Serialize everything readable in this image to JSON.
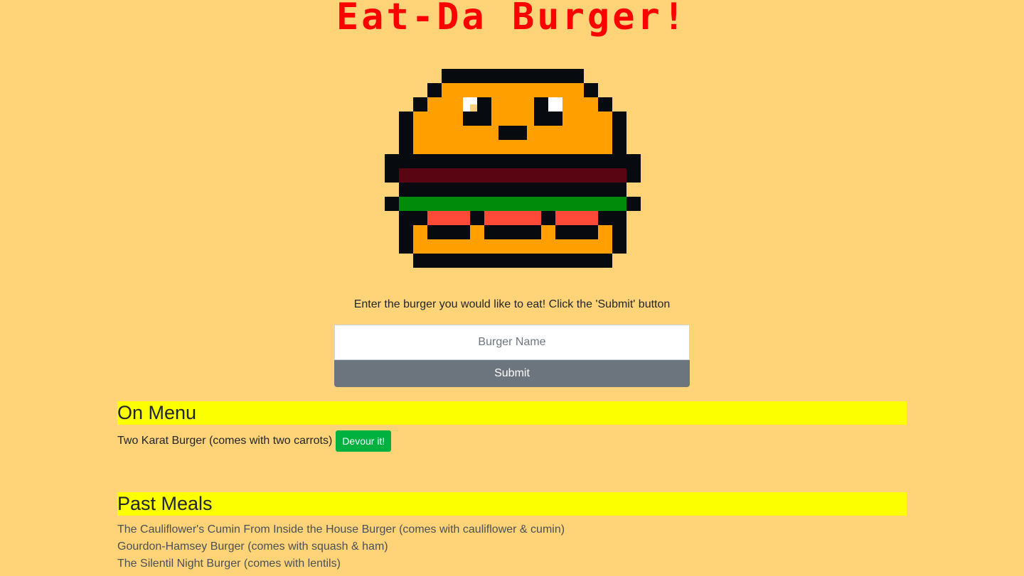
{
  "header": {
    "title": "Eat-Da Burger!"
  },
  "hero": {
    "image_icon": "pixel-burger-icon",
    "colors": {
      "outline": "#070a0e",
      "bun": "#ff9f00",
      "patty": "#5a0512",
      "lettuce": "#008c0a",
      "tomato": "#ff4a3a",
      "eye_highlight": "#ffffff"
    }
  },
  "form": {
    "instructions": "Enter the burger you would like to eat! Click the 'Submit' button",
    "input_placeholder": "Burger Name",
    "input_value": "",
    "submit_label": "Submit"
  },
  "on_menu": {
    "heading": "On Menu",
    "items": [
      {
        "name": "Two Karat Burger (comes with two carrots)",
        "button_label": "Devour it!"
      }
    ]
  },
  "past_meals": {
    "heading": "Past Meals",
    "items": [
      "The Cauliflower's Cumin From Inside the House Burger (comes with cauliflower & cumin)",
      "Gourdon-Hamsey Burger (comes with squash & ham)",
      "The Silentil Night Burger (comes with lentils)"
    ]
  },
  "colors": {
    "background": "#ffd479",
    "title": "#ff0000",
    "section_highlight": "#fbff00",
    "submit_button": "#6c757d",
    "devour_button": "#00b140"
  }
}
